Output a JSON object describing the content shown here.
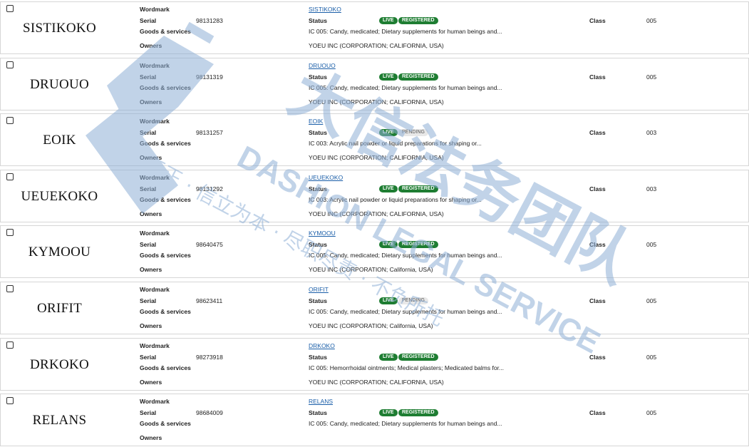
{
  "labels": {
    "wordmark": "Wordmark",
    "serial": "Serial",
    "goods": "Goods & services",
    "owners": "Owners",
    "status": "Status",
    "class": "Class"
  },
  "records": [
    {
      "mark": "SISTIKOKO",
      "serial": "98131283",
      "name": "SISTIKOKO",
      "live": "LIVE",
      "status": "REGISTERED",
      "goods": "IC 005: Candy, medicated; Dietary supplements for human beings and...",
      "owner": "YOEU INC (CORPORATION; CALIFORNIA, USA)",
      "class": "005"
    },
    {
      "mark": "DRUOUO",
      "serial": "98131319",
      "name": "DRUOUO",
      "live": "LIVE",
      "status": "REGISTERED",
      "goods": "IC 005: Candy, medicated; Dietary supplements for human beings and...",
      "owner": "YOEU INC (CORPORATION; CALIFORNIA, USA)",
      "class": "005"
    },
    {
      "mark": "EOIK",
      "serial": "98131257",
      "name": "EOIK",
      "live": "LIVE",
      "status": "PENDING",
      "goods": "IC 003: Acrylic nail powder or liquid preparations for shaping or...",
      "owner": "YOEU INC (CORPORATION; CALIFORNIA, USA)",
      "class": "003"
    },
    {
      "mark": "UEUEKOKO",
      "serial": "98131292",
      "name": "UEUEKOKO",
      "live": "LIVE",
      "status": "REGISTERED",
      "goods": "IC 003: Acrylic nail powder or liquid preparations for shaping or...",
      "owner": "YOEU INC (CORPORATION; CALIFORNIA, USA)",
      "class": "003"
    },
    {
      "mark": "KYMOOU",
      "serial": "98640475",
      "name": "KYMOOU",
      "live": "LIVE",
      "status": "REGISTERED",
      "goods": "IC 005: Candy, medicated; Dietary supplements for human beings and...",
      "owner": "YOEU INC (CORPORATION; California, USA)",
      "class": "005"
    },
    {
      "mark": "ORIFIT",
      "serial": "98623411",
      "name": "ORIFIT",
      "live": "LIVE",
      "status": "PENDING",
      "goods": "IC 005: Candy, medicated; Dietary supplements for human beings and...",
      "owner": "YOEU INC (CORPORATION; California, USA)",
      "class": "005"
    },
    {
      "mark": "DRKOKO",
      "serial": "98273918",
      "name": "DRKOKO",
      "live": "LIVE",
      "status": "REGISTERED",
      "goods": "IC 005: Hemorrhoidal ointments; Medical plasters; Medicated balms for...",
      "owner": "YOEU INC (CORPORATION; CALIFORNIA, USA)",
      "class": "005"
    },
    {
      "mark": "RELANS",
      "serial": "98684009",
      "name": "RELANS",
      "live": "LIVE",
      "status": "REGISTERED",
      "goods": "IC 005: Candy, medicated; Dietary supplements for human beings and...",
      "owner": "",
      "class": "005"
    }
  ],
  "watermark": {
    "cn_big": "大信法务团队",
    "en": "DASHION LEGAL SERVICE",
    "cn_line": "大公至正 · 信立为本 · 尽职尽责 · 不负所托",
    "color": "#8fb0d6"
  }
}
